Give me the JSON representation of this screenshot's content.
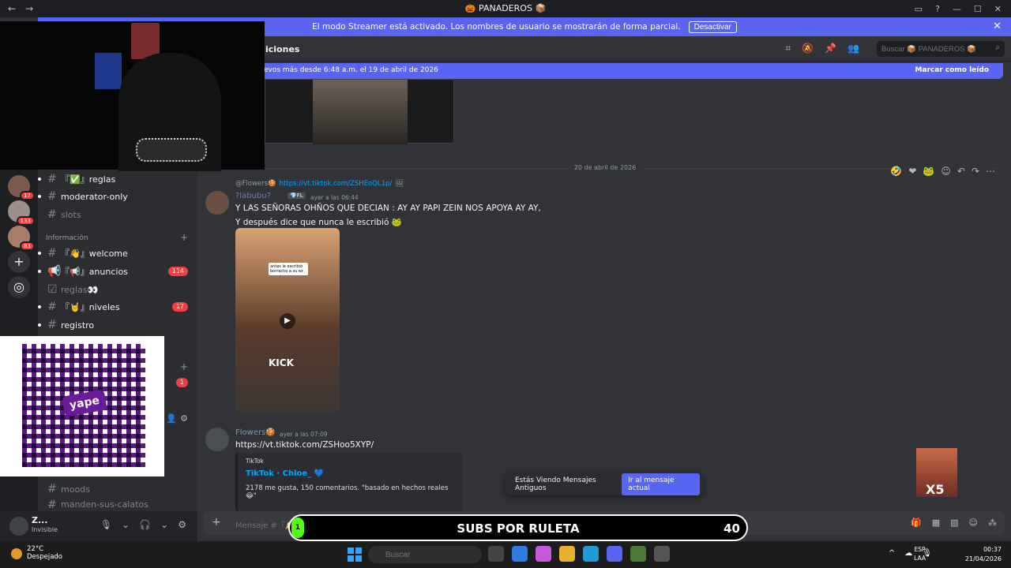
{
  "window": {
    "title": "🎃 PANADEROS 📦",
    "nav_back": "←",
    "nav_forward": "→"
  },
  "streamer_bar": {
    "message": "El modo Streamer está activado. Los nombres de usuario se mostrarán de forma parcial.",
    "button": "Desactivar"
  },
  "guilds": [
    {
      "badge": "17"
    },
    {
      "badge": "133"
    },
    {
      "badge": "83"
    }
  ],
  "channels": {
    "items": [
      {
        "prefix": "#",
        "label": "『✅』reglas"
      },
      {
        "prefix": "#",
        "label": "moderator-only"
      },
      {
        "prefix": "#",
        "label": "slots",
        "muted": true
      }
    ],
    "category_info": "Información",
    "info_items": [
      {
        "prefix": "#",
        "label": "『👋』welcome"
      },
      {
        "prefix": "📢",
        "label": "『📢』anuncios",
        "badge": "114"
      },
      {
        "prefix": "☑",
        "label": "reglas👀",
        "muted": true
      },
      {
        "prefix": "#",
        "label": "『🤘』niveles",
        "badge": "17"
      },
      {
        "prefix": "#",
        "label": "registro"
      }
    ],
    "unread_badge": "1",
    "bottom_items": [
      {
        "prefix": "#",
        "label": "moods",
        "muted": true
      },
      {
        "prefix": "#",
        "label": "manden-sus-calatos",
        "muted": true
      }
    ]
  },
  "user_panel": {
    "name": "Z...",
    "status": "Invisible"
  },
  "header": {
    "title": "iciones",
    "search_placeholder": "Buscar 📦 PANADEROS 📦"
  },
  "new_messages_bar": {
    "text": "evos más desde 6:48 a.m. el 19 de abril de 2026",
    "mark_read": "Marcar como leído"
  },
  "date_divider": "20 de abril de 2026",
  "message1": {
    "reply_author": "@Flowers🍪",
    "reply_link": "https://vt.tiktok.com/ZSHEoQL1p/",
    "author": "?labubu?",
    "tag": "💎FL",
    "time": "ayer a las 06:44",
    "line1": "Y LAS SEÑORAS OHÑOS QUE DECIAN : AY AY PAPI ZEIN NOS APOYA AY AY,",
    "line2": "Y después dice que nunca le escribió 🐸",
    "media_caption": "KICK",
    "media_overlay": "antes le escribió borracho a su ex"
  },
  "message2": {
    "author": "Flowers🍪",
    "time": "ayer a las 07:09",
    "link": "https://vt.tiktok.com/ZSHoo5XYP/",
    "embed_provider": "TikTok",
    "embed_title": "TikTok · Chloe_ 💙",
    "embed_desc": "2178 me gusta, 150 comentarios. \"basado en hechos reales 😂\""
  },
  "old_messages": {
    "text": "Estás Viendo Mensajes Antiguos",
    "button": "Ir al mensaje actual"
  },
  "composer": {
    "placeholder": "Mensaje #『🔔』reacciones"
  },
  "overlay": {
    "sub_text": "SUBS POR RULETA",
    "sub_count": "40",
    "sub_start": "1",
    "qr_logo": "yape",
    "emote_mult": "X5"
  },
  "taskbar": {
    "temp": "22°C",
    "condition": "Despejado",
    "search": "Buscar",
    "lang1": "ESP",
    "lang2": "LAA",
    "time": "00:37",
    "date": "21/04/2026"
  }
}
